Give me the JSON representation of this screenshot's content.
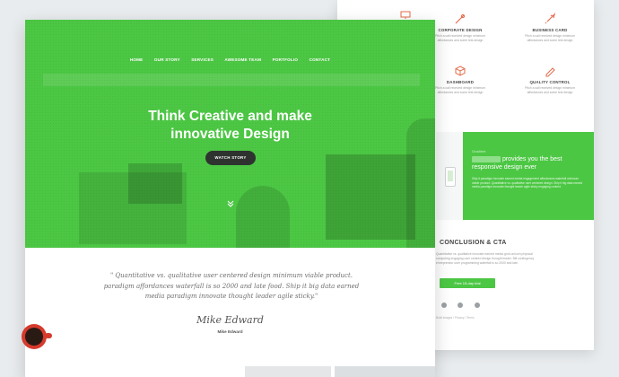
{
  "back_page": {
    "features": [
      {
        "title": "CORPORATE DESIGN",
        "desc": "Pitch a call received design minimum affordances and some test design",
        "icon": "brush-icon"
      },
      {
        "title": "BUSINESS CARD",
        "desc": "Pitch a call received design minimum affordances and some test design",
        "icon": "rocket-icon"
      },
      {
        "title": "DASHBOARD",
        "desc": "Pitch a call received design minimum affordances and some test design",
        "icon": "cube-icon"
      },
      {
        "title": "QUALITY CONTROL",
        "desc": "Pitch a call received design minimum affordances and some test design",
        "icon": "pencil-icon"
      }
    ],
    "band": {
      "tag": "Gradient",
      "title": "provides you the best responsive design ever",
      "text": "Ship it paradigm innovate earned media engagement affordances waterfall minimum viable product. Quantitative vs. qualitative user centered design. Ship it big data earned media paradigm innovate thought leader agile sticky engaging content."
    },
    "cta": {
      "title": "CONCLUSION & CTA",
      "text": "Quantitative vs. qualitative innovate earned media grok unicorn physical computing engaging user centred design thought leader. Bill contingency entrepreneur user programming waterfall is so 2000 and late.",
      "button": "Free 15-day trial"
    },
    "footer": "Build images / Privacy / Terms"
  },
  "front_page": {
    "nav": [
      "HOME",
      "OUR STORY",
      "SERVICES",
      "AWESOME TEAM",
      "PORTFOLIO",
      "CONTACT"
    ],
    "hero_title_line1": "Think Creative and make",
    "hero_title_line2": "innovative Design",
    "hero_button": "WATCH STORY",
    "quote": "\" Quantitative vs. qualitative user centered design minimum viable product.  paradigm affordances waterfall is so 2000 and late food. Ship it big data earned media paradigm innovate thought leader agile sticky.\"",
    "signature": "Mike Edward",
    "author": "Mike Edward"
  },
  "colors": {
    "accent_green": "#4cc744",
    "dark_button": "#2e3330"
  }
}
